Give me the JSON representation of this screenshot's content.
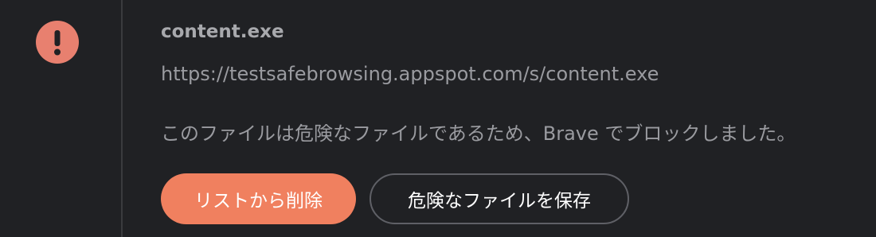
{
  "download_item": {
    "filename": "content.exe",
    "url": "https://testsafebrowsing.appspot.com/s/content.exe",
    "message": "このファイルは危険なファイルであるため、Brave でブロックしました。",
    "icon": "danger-exclamation-icon",
    "buttons": {
      "remove_label": "リストから削除",
      "keep_label": "危険なファイルを保存"
    }
  },
  "colors": {
    "background": "#202124",
    "icon_circle": "#e8806f",
    "icon_glyph": "#202124",
    "primary_button": "#f0805f",
    "secondary_border": "#5f6066",
    "text_muted": "#9a9ba0"
  }
}
